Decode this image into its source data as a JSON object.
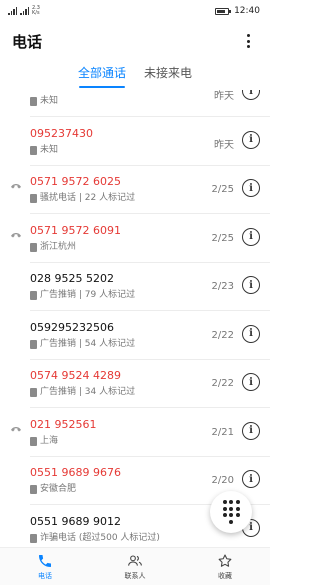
{
  "status_bar": {
    "speed_value": "2.3",
    "speed_unit": "K/s",
    "time": "12:40",
    "battery_level": 0.8,
    "icons": [
      "signal-icon",
      "signal-icon",
      "battery-icon"
    ]
  },
  "header": {
    "title": "电话",
    "more_icon": "more-vertical-icon"
  },
  "tabs": [
    {
      "label": "全部通话",
      "active": true
    },
    {
      "label": "未接来电",
      "active": false
    }
  ],
  "calls": [
    {
      "number": "",
      "tag": "未知",
      "date": "昨天",
      "missed": false,
      "incoming_icon": false
    },
    {
      "number": "095237430",
      "tag": "未知",
      "date": "昨天",
      "missed": true,
      "incoming_icon": false
    },
    {
      "number": "0571 9572 6025",
      "tag": "骚扰电话 | 22 人标记过",
      "date": "2/25",
      "missed": true,
      "incoming_icon": true
    },
    {
      "number": "0571 9572 6091",
      "tag": "浙江杭州",
      "date": "2/25",
      "missed": true,
      "incoming_icon": true
    },
    {
      "number": "028 9525 5202",
      "tag": "广告推销 | 79 人标记过",
      "date": "2/23",
      "missed": false,
      "incoming_icon": false
    },
    {
      "number": "059295232506",
      "tag": "广告推销 | 54 人标记过",
      "date": "2/22",
      "missed": false,
      "incoming_icon": false
    },
    {
      "number": "0574 9524 4289",
      "tag": "广告推销 | 34 人标记过",
      "date": "2/22",
      "missed": true,
      "incoming_icon": false
    },
    {
      "number": "021 952561",
      "tag": "上海",
      "date": "2/21",
      "missed": true,
      "incoming_icon": true
    },
    {
      "number": "0551 9689 9676",
      "tag": "安徽合肥",
      "date": "2/20",
      "missed": true,
      "incoming_icon": false
    },
    {
      "number": "0551 9689 9012",
      "tag": "诈骗电话 (超过500 人标记过)",
      "date": "",
      "missed": false,
      "incoming_icon": false
    }
  ],
  "fab": {
    "icon": "dialpad-icon"
  },
  "bottom_nav": [
    {
      "label": "电话",
      "icon": "phone-icon",
      "active": true
    },
    {
      "label": "联系人",
      "icon": "contacts-icon",
      "active": false
    },
    {
      "label": "收藏",
      "icon": "star-icon",
      "active": false
    }
  ],
  "colors": {
    "accent": "#0a84ff",
    "missed": "#e53935"
  }
}
